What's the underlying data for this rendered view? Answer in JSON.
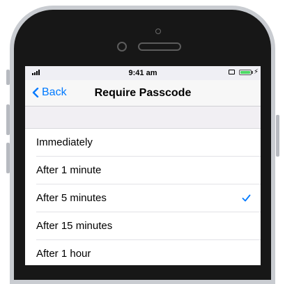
{
  "status_bar": {
    "time": "9:41 am",
    "charging_symbol": "⚡"
  },
  "nav": {
    "back_label": "Back",
    "title": "Require Passcode"
  },
  "options": [
    {
      "label": "Immediately",
      "selected": false
    },
    {
      "label": "After 1 minute",
      "selected": false
    },
    {
      "label": "After 5 minutes",
      "selected": true
    },
    {
      "label": "After 15 minutes",
      "selected": false
    },
    {
      "label": "After 1 hour",
      "selected": false
    }
  ],
  "colors": {
    "accent": "#007aff",
    "battery": "#4cd964",
    "group_background": "#efeff4"
  },
  "icons": {
    "back": "chevron-left-icon",
    "selected": "checkmark-icon",
    "signal": "signal-icon",
    "airplay": "airplay-icon",
    "battery": "battery-icon"
  }
}
